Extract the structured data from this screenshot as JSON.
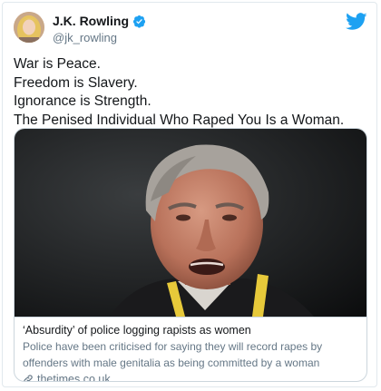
{
  "author": {
    "display_name": "J.K. Rowling",
    "handle": "@jk_rowling",
    "verified_icon": "verified-badge-icon"
  },
  "tweet": {
    "lines": [
      "War is Peace.",
      "Freedom is Slavery.",
      "Ignorance is Strength.",
      "The Penised Individual Who Raped You Is a Woman."
    ]
  },
  "link_card": {
    "title": "‘Absurdity’ of police logging rapists as women",
    "description_lines": [
      "Police have been criticised for saying they will record rapes by",
      "offenders with male genitalia as being committed by a woman"
    ],
    "domain": "thetimes.co.uk"
  },
  "colors": {
    "brand_blue": "#1da1f2",
    "text_primary": "#14171a",
    "text_secondary": "#657786",
    "border": "#ccd6dd"
  }
}
